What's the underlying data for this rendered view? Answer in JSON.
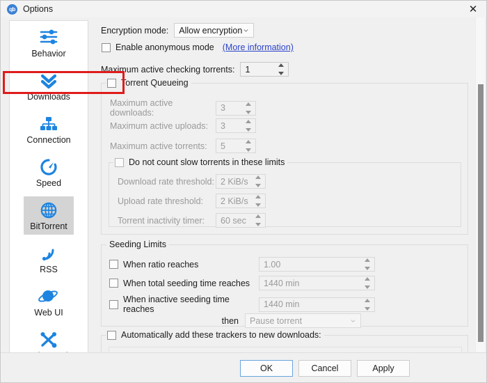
{
  "window": {
    "title": "Options",
    "logo_text": "qb",
    "close_icon": "✕"
  },
  "sidebar": {
    "items": [
      {
        "label": "Behavior",
        "icon": "sliders-icon",
        "selected": false
      },
      {
        "label": "Downloads",
        "icon": "double-chevron-down-icon",
        "selected": false
      },
      {
        "label": "Connection",
        "icon": "network-icon",
        "selected": false
      },
      {
        "label": "Speed",
        "icon": "speedometer-icon",
        "selected": false
      },
      {
        "label": "BitTorrent",
        "icon": "globe-icon",
        "selected": true
      },
      {
        "label": "RSS",
        "icon": "rss-icon",
        "selected": false
      },
      {
        "label": "Web UI",
        "icon": "planet-icon",
        "selected": false
      },
      {
        "label": "Advanced",
        "icon": "tools-icon",
        "selected": false
      }
    ]
  },
  "main": {
    "encryption": {
      "label": "Encryption mode:",
      "value": "Allow encryption"
    },
    "anonymous": {
      "label": "Enable anonymous mode",
      "link": "(More information)",
      "checked": false
    },
    "max_checking": {
      "label": "Maximum active checking torrents:",
      "value": "1"
    },
    "queueing": {
      "title": "Torrent Queueing",
      "checked": false,
      "rows": [
        {
          "label": "Maximum active downloads:",
          "value": "3"
        },
        {
          "label": "Maximum active uploads:",
          "value": "3"
        },
        {
          "label": "Maximum active torrents:",
          "value": "5"
        }
      ],
      "slow": {
        "title": "Do not count slow torrents in these limits",
        "checked": false,
        "rows": [
          {
            "label": "Download rate threshold:",
            "value": "2 KiB/s"
          },
          {
            "label": "Upload rate threshold:",
            "value": "2 KiB/s"
          },
          {
            "label": "Torrent inactivity timer:",
            "value": "60 sec"
          }
        ]
      }
    },
    "seeding": {
      "title": "Seeding Limits",
      "rows": [
        {
          "label": "When ratio reaches",
          "value": "1.00",
          "checked": false
        },
        {
          "label": "When total seeding time reaches",
          "value": "1440 min",
          "checked": false
        },
        {
          "label": "When inactive seeding time reaches",
          "value": "1440 min",
          "checked": false
        }
      ],
      "then_label": "then",
      "then_value": "Pause torrent"
    },
    "trackers": {
      "title": "Automatically add these trackers to new downloads:",
      "checked": false,
      "value": ""
    }
  },
  "footer": {
    "ok": "OK",
    "cancel": "Cancel",
    "apply": "Apply"
  },
  "colors": {
    "accent": "#1d84e0",
    "highlight": "#e01b1b",
    "link": "#2b43c9"
  }
}
